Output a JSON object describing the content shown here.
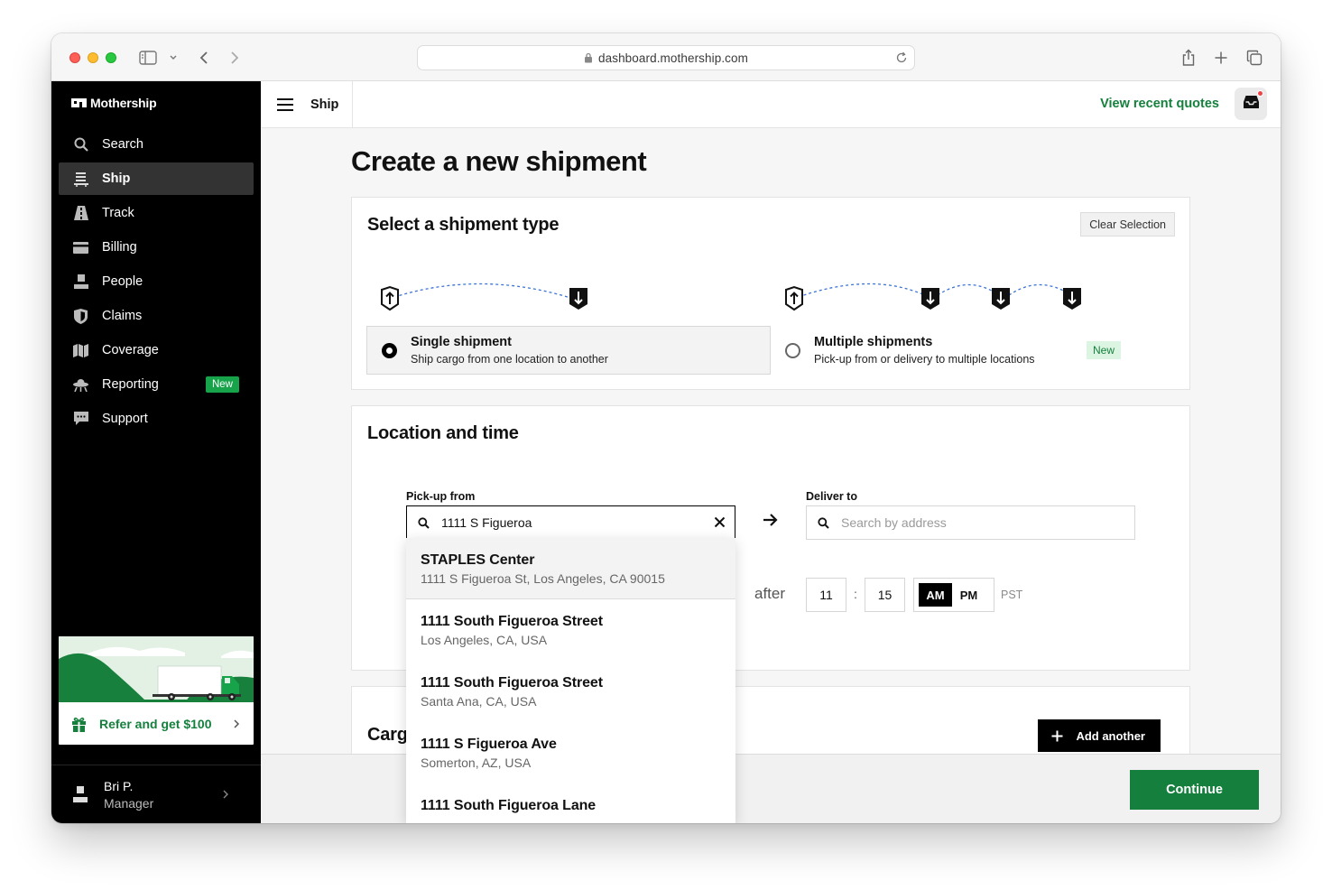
{
  "browser": {
    "url": "dashboard.mothership.com"
  },
  "brand": {
    "name": "Mothership"
  },
  "sidebar": {
    "items": [
      {
        "label": "Search",
        "icon": "search-icon"
      },
      {
        "label": "Ship",
        "icon": "ship-list-icon",
        "active": true
      },
      {
        "label": "Track",
        "icon": "road-icon"
      },
      {
        "label": "Billing",
        "icon": "credit-card-icon"
      },
      {
        "label": "People",
        "icon": "person-icon"
      },
      {
        "label": "Claims",
        "icon": "shield-icon"
      },
      {
        "label": "Coverage",
        "icon": "map-icon"
      },
      {
        "label": "Reporting",
        "icon": "ufo-icon",
        "badge": "New"
      },
      {
        "label": "Support",
        "icon": "chat-icon"
      }
    ],
    "refer": {
      "label": "Refer and get $100"
    },
    "user": {
      "name": "Bri P.",
      "role": "Manager"
    }
  },
  "header": {
    "section": "Ship",
    "recent_quotes": "View recent quotes"
  },
  "main": {
    "title": "Create a new shipment",
    "shipment_type": {
      "title": "Select a shipment type",
      "clear": "Clear Selection",
      "options": [
        {
          "title": "Single shipment",
          "subtitle": "Ship cargo from one location to another",
          "selected": true
        },
        {
          "title": "Multiple shipments",
          "subtitle": "Pick-up from or delivery to multiple locations",
          "badge": "New",
          "selected": false
        }
      ]
    },
    "location": {
      "title": "Location and time",
      "pickup_label": "Pick-up from",
      "pickup_value": "1111 S Figueroa",
      "deliver_label": "Deliver to",
      "deliver_placeholder": "Search by address",
      "after_label": "after",
      "hour": "11",
      "minute": "15",
      "am": "AM",
      "pm": "PM",
      "period_selected": "AM",
      "timezone": "PST"
    },
    "cargo": {
      "title": "Cargo",
      "add_label": "Add another"
    },
    "suggestions": [
      {
        "name": "STAPLES Center",
        "address": "1111 S Figueroa St, Los Angeles, CA 90015"
      },
      {
        "name": "1111 South Figueroa Street",
        "address": "Los Angeles, CA, USA"
      },
      {
        "name": "1111 South Figueroa Street",
        "address": "Santa Ana, CA, USA"
      },
      {
        "name": "1111 S Figueroa Ave",
        "address": "Somerton, AZ, USA"
      },
      {
        "name": "1111 South Figueroa Lane",
        "address": ""
      }
    ]
  },
  "footer": {
    "continue": "Continue"
  },
  "colors": {
    "accent_green": "#15803d",
    "badge_green": "#16a34a",
    "sidebar_bg": "#000000"
  }
}
